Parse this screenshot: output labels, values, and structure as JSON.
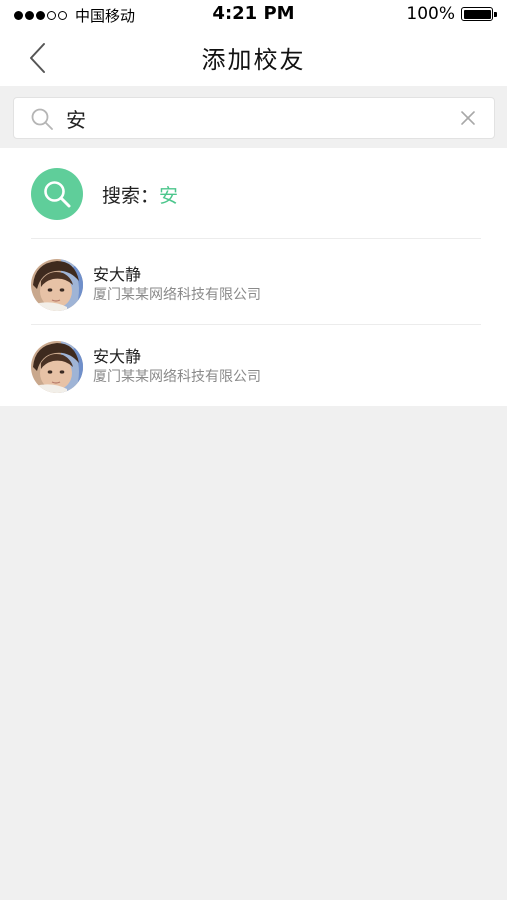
{
  "status_bar": {
    "carrier": "中国移动",
    "time": "4:21 PM",
    "battery": "100%"
  },
  "nav": {
    "title": "添加校友"
  },
  "search": {
    "value": "安",
    "placeholder": ""
  },
  "search_suggestion": {
    "prefix": "搜索：",
    "keyword": "安"
  },
  "results": [
    {
      "name": "安大静",
      "company": "厦门某某网络科技有限公司"
    },
    {
      "name": "安大静",
      "company": "厦门某某网络科技有限公司"
    }
  ],
  "colors": {
    "accent": "#5fce9a",
    "keyword": "#4cc68c",
    "background": "#f0f0f0"
  },
  "icons": {
    "back": "chevron-left-icon",
    "search": "search-icon",
    "clear": "close-icon"
  }
}
